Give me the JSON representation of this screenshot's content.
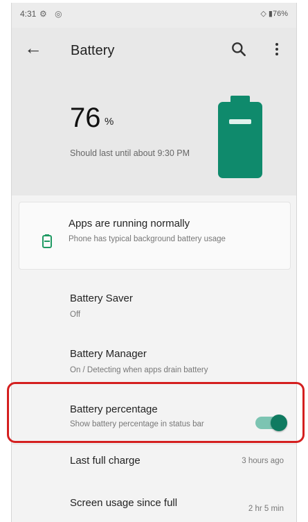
{
  "status_bar": {
    "time": "4:31",
    "icons": [
      "gear-icon",
      "at-icon"
    ],
    "right": "◇ ▮76%"
  },
  "app_bar": {
    "title": "Battery"
  },
  "battery_header": {
    "percent": "76",
    "percent_unit": "%",
    "estimate": "Should last until about 9:30 PM",
    "accent_color": "#0f8a6c"
  },
  "tip": {
    "title": "Apps are running normally",
    "subtitle": "Phone has typical background battery usage"
  },
  "settings": {
    "battery_saver": {
      "title": "Battery Saver",
      "value": "Off"
    },
    "battery_manager": {
      "title": "Battery Manager",
      "value": "On / Detecting when apps drain battery"
    },
    "battery_percentage": {
      "title": "Battery percentage",
      "subtitle": "Show battery percentage in status bar",
      "enabled": true
    },
    "last_full_charge": {
      "title": "Last full charge",
      "value": "3 hours ago"
    },
    "screen_usage": {
      "title": "Screen usage since full",
      "value": "2 hr 5 min"
    }
  }
}
